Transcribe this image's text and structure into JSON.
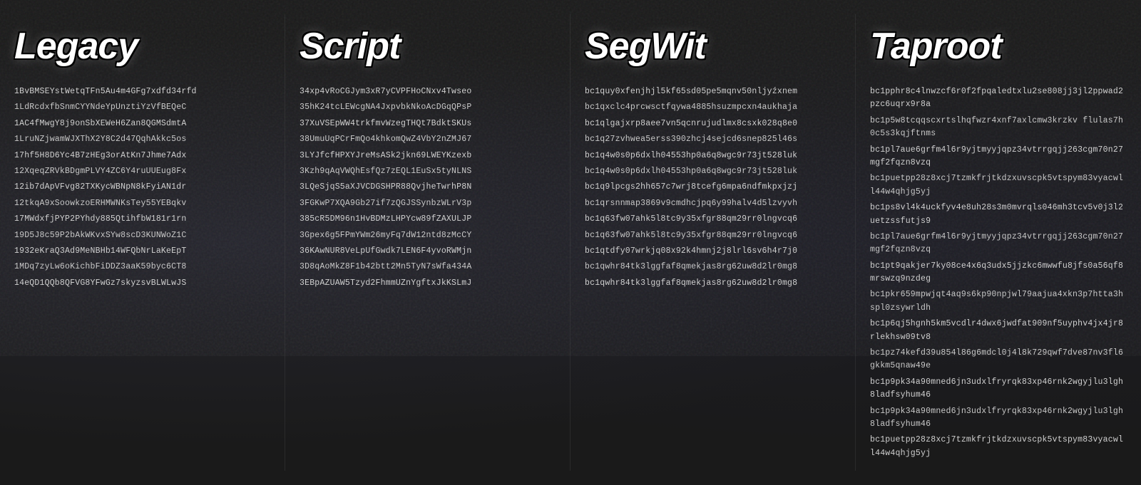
{
  "columns": [
    {
      "id": "legacy",
      "title": "Legacy",
      "addresses": [
        "1BvBMSEYstWetqTFn5Au4m4GFg7xdfd34rfd",
        "1LdRcdxfbSnmCYYNdeYpUnztiYzVfBEQeC",
        "1AC4fMwgY8j9onSbXEWeH6Zan8QGMSdmtA",
        "1LruNZjwamWJXThX2Y8C2d47QqhAkkc5os",
        "17hf5H8D6Yc4B7zHEg3orAtKn7Jhme7Adx",
        "12XqeqZRVkBDgmPLVY4ZC6Y4ruUUEug8Fx",
        "12ib7dApVFvg82TXKycWBNpN8kFyiAN1dr",
        "12tkqA9xSoowkzoERHMWNKsTey55YEBqkv",
        "17MWdxfjPYP2PYhdy885QtihfbW181r1rn",
        "19D5J8c59P2bAkWKvxSYw8scD3KUNWoZ1C",
        "1932eKraQ3Ad9MeNBHb14WFQbNrLaKeEpT",
        "1MDq7zyLw6oKichbFiDDZ3aaK59byc6CT8",
        "14eQD1QQb8QFVG8YFwGz7skyzsvBLWLwJS"
      ]
    },
    {
      "id": "script",
      "title": "Script",
      "addresses": [
        "34xp4vRoCGJym3xR7yCVPFHoCNxv4Twseo",
        "35hK24tcLEWcgNA4JxpvbkNkoAcDGqQPsP",
        "37XuVSEpWW4trkfmvWzegTHQt7BdktSKUs",
        "38UmuUqPCrFmQo4khkomQwZ4VbY2nZMJ67",
        "3LYJfcfHPXYJreMsASk2jkn69LWEYKzexb",
        "3Kzh9qAqVWQhEsfQz7zEQL1EuSx5tyNLNS",
        "3LQeSjqS5aXJVCDGSHPR88QvjheTwrhP8N",
        "3FGKwP7XQA9Gb27if7zQGJSSynbzWLrV3p",
        "385cR5DM96n1HvBDMzLHPYcw89fZAXULJP",
        "3Gpex6g5FPmYWm26myFq7dW12ntd8zMcCY",
        "36KAwNUR8VeLpUfGwdk7LEN6F4yvoRWMjn",
        "3D8qAoMkZ8F1b42btt2Mn5TyN7sWfa434A",
        "3EBpAZUAW5Tzyd2FhmmUZnYgftxJkKSLmJ"
      ]
    },
    {
      "id": "segwit",
      "title": "SegWit",
      "addresses": [
        "bc1quy0xfenjhjl5kf65sd05pe5mqnv50nljyźxnem",
        "bc1qxclc4prcwsctfqywa4885hsuzmpcxn4aukhaja",
        "bc1qlgajxrp8aee7vn5qcnrujudlmx8csxk028q8e0",
        "bc1q27zvhwea5erss390zhcj4sejcd6snep825l46s",
        "bc1q4w0s0p6dxlh04553hp0a6q8wgc9r73jt528luk",
        "bc1q4w0s0p6dxlh04553hp0a6q8wgc9r73jt528luk",
        "bc1q9lpcgs2hh657c7wrj8tcefg6mpa6ndfmkpxjzj",
        "bc1qrsnnmap3869v9cmdhcjpq6y99halv4d5lzvyvh",
        "bc1q63fw07ahk5l8tc9y35xfgr88qm29rr0lngvcq6",
        "bc1q63fw07ahk5l8tc9y35xfgr88qm29rr0lngvcq6",
        "bc1qtdfy07wrkjq08x92k4hmnj2j8lrl6sv6h4r7j0",
        "bc1qwhr84tk3lggfaf8qmekjas8rg62uw8d2lr0mg8",
        "bc1qwhr84tk3lggfaf8qmekjas8rg62uw8d2lr0mg8"
      ]
    },
    {
      "id": "taproot",
      "title": "Taproot",
      "addresses": [
        "bc1pphr8c4lnwzcf6r0f2fpqaledtxlu2se808jj3jl2ppwad2pzc6uqrx9r8a",
        "bc1p5w8tcqqscxrtslhqfwzr4xnf7axlcmw3krzkv flulas7h0c5s3kqjftnms",
        "bc1pl7aue6grfm4l6r9yjtmyyjqpz34vtrrgqjj263cgm70n27mgf2fqzn8vzq",
        "bc1puetpp28z8xcj7tzmkfrjtkdzxuvscpk5vtspym83vyacwll44w4qhjg5yj",
        "bc1ps8vl4k4uckfyv4e8uh28s3m0mvrqls046mh3tcv5v0j3l2uetzssfutjs9",
        "bc1pl7aue6grfm4l6r9yjtmyyjqpz34vtrrgqjj263cgm70n27mgf2fqzn8vzq",
        "bc1pt9qakjer7ky08ce4x6q3udx5jjzkc6mwwfu8jfs0a56qf8mrswzq9nzdeg",
        "bc1pkr659mpwjqt4aq9s6kp90npjwl79aajua4xkn3p7htta3hspl0zsywrldh",
        "bc1p6qj5hgnh5km5vcdlr4dwx6jwdfat909nf5uyphv4jx4jr8rlekhsw09tv8",
        "bc1pz74kefd39u854l86g6mdcl0j4l8k729qwf7dve87nv3fl6gkkm5qnaw49e",
        "bc1p9pk34a90mned6jn3udxlfryrqk83xp46rnk2wgyjlu3lgh8ladfsyhum46",
        "bc1p9pk34a90mned6jn3udxlfryrqk83xp46rnk2wgyjlu3lgh8ladfsyhum46",
        "bc1puetpp28z8xcj7tzmkfrjtkdzxuvscpk5vtspym83vyacwll44w4qhjg5yj"
      ]
    }
  ]
}
